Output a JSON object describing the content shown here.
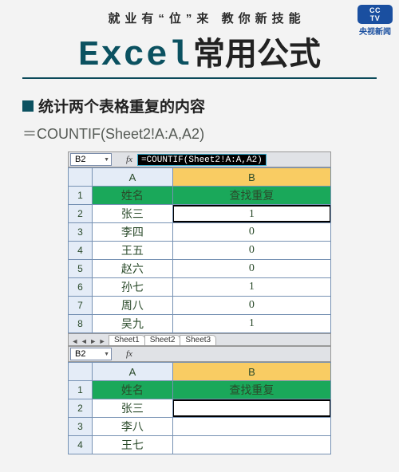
{
  "logo": {
    "brand1": "CC",
    "brand2": "TV",
    "subtext": "央视新闻"
  },
  "slogan": "就业有“位”来 教你新技能",
  "title": {
    "en": "Excel",
    "cn": "常用公式"
  },
  "section_title": "统计两个表格重复的内容",
  "formula_display": "＝COUNTIF(Sheet2!A:A,A2)",
  "shot1": {
    "active_cell": "B2",
    "fx_label": "fx",
    "fx_value": "=COUNTIF(Sheet2!A:A,A2)",
    "columns": [
      "A",
      "B"
    ],
    "header_row": [
      "姓名",
      "查找重复"
    ],
    "rows": [
      {
        "n": "1"
      },
      {
        "n": "2",
        "a": "张三",
        "b": "1"
      },
      {
        "n": "3",
        "a": "李四",
        "b": "0"
      },
      {
        "n": "4",
        "a": "王五",
        "b": "0"
      },
      {
        "n": "5",
        "a": "赵六",
        "b": "0"
      },
      {
        "n": "6",
        "a": "孙七",
        "b": "1"
      },
      {
        "n": "7",
        "a": "周八",
        "b": "0"
      },
      {
        "n": "8",
        "a": "吴九",
        "b": "1"
      }
    ],
    "tabs": [
      "Sheet1",
      "Sheet2",
      "Sheet3"
    ]
  },
  "shot2": {
    "active_cell": "B2",
    "fx_label": "fx",
    "fx_value": "",
    "columns": [
      "A",
      "B"
    ],
    "header_row": [
      "姓名",
      "查找重复"
    ],
    "rows": [
      {
        "n": "1"
      },
      {
        "n": "2",
        "a": "张三",
        "b": ""
      },
      {
        "n": "3",
        "a": "李八",
        "b": ""
      },
      {
        "n": "4",
        "a": "王七",
        "b": ""
      }
    ]
  }
}
